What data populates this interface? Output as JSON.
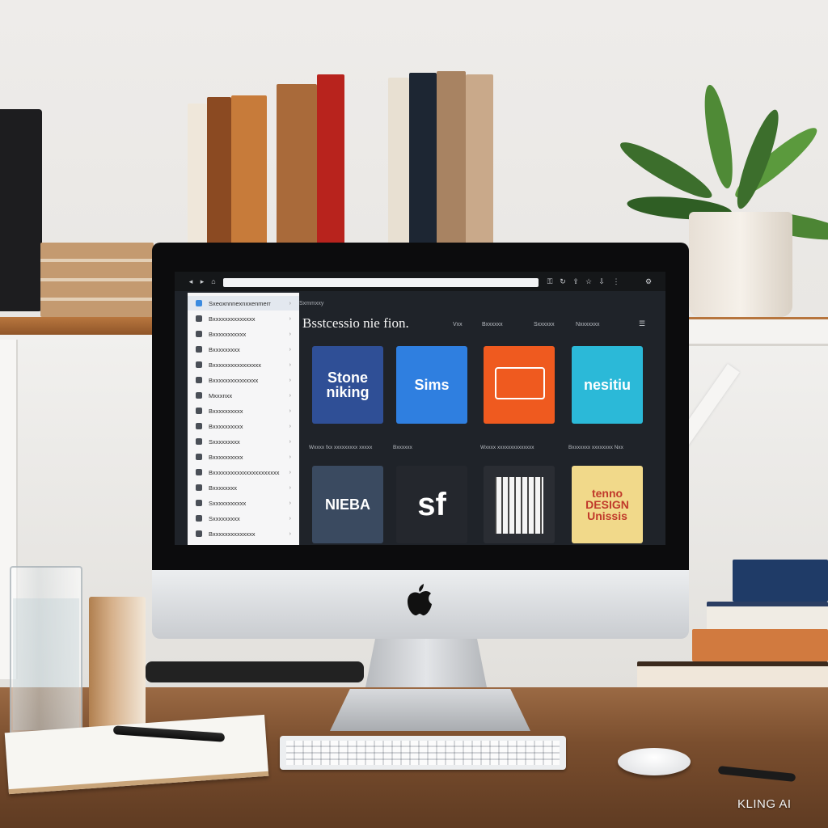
{
  "watermark": "KLING AI",
  "browser": {
    "url": "",
    "toolbar_icons": [
      "lock-icon",
      "refresh-icon",
      "share-icon",
      "bookmark-icon",
      "download-icon",
      "extensions-icon"
    ]
  },
  "sidebar": {
    "items": [
      {
        "label": "Sxeoxnnnexnxxenmerr",
        "icon": "folder-icon"
      },
      {
        "label": "Bxxxxxxxxxxxxxx",
        "icon": "folder-icon"
      },
      {
        "label": "Bxxxxxxxxxxx",
        "icon": "folder-icon"
      },
      {
        "label": "Bxxxxxxxxx",
        "icon": "folder-icon"
      },
      {
        "label": "Bxxxxxxxxxxxxxxxx",
        "icon": "folder-icon"
      },
      {
        "label": "Bxxxxxxxxxxxxxxx",
        "icon": "folder-icon"
      },
      {
        "label": "Mxxxnxx",
        "icon": "folder-icon"
      },
      {
        "label": "Bxxxxxxxxxx",
        "icon": "folder-icon"
      },
      {
        "label": "Bxxxxxxxxxx",
        "icon": "folder-icon"
      },
      {
        "label": "Sxxxxxxxxx",
        "icon": "folder-icon"
      },
      {
        "label": "Bxxxxxxxxxx",
        "icon": "folder-icon"
      },
      {
        "label": "Bxxxxxxxxxxxxxxxxxxxxxx",
        "icon": "folder-icon"
      },
      {
        "label": "Bxxxxxxxx",
        "icon": "folder-icon"
      },
      {
        "label": "Sxxxxxxxxxxx",
        "icon": "folder-icon"
      },
      {
        "label": "Sxxxxxxxxx",
        "icon": "folder-icon"
      },
      {
        "label": "Bxxxxxxxxxxxxxx",
        "icon": "folder-icon"
      }
    ]
  },
  "main": {
    "breadcrumb": "Sxmmxxy",
    "title": "Bsstcessio nie fion.",
    "nav": [
      "Vxx",
      "Bxxxxxx",
      "Sxxxxxx",
      "Nxxxxxxx"
    ],
    "tiles": [
      {
        "art": "Stone\nniking",
        "caption": "Wxxxx fxx xxxxxxxxx xxxxx",
        "bg": "#2f4f96"
      },
      {
        "art": "Sims",
        "caption": "Bxxxxxx",
        "bg": "#2f7fe0"
      },
      {
        "art": "",
        "caption": "Wxxxx xxxxxxxxxxxxxx",
        "bg": "#ef5a1f"
      },
      {
        "art": "nesitiu",
        "caption": "Bxxxxxxx xxxxxxxx Nxx",
        "bg": "#2bb9d8"
      },
      {
        "art": "NIEBA",
        "caption": "",
        "bg": "#3a4a60"
      },
      {
        "art": "sf",
        "caption": "",
        "bg": "#24272d"
      },
      {
        "art": "",
        "caption": "",
        "bg": "#2a2d33"
      },
      {
        "art": "tenno\nDESIGN\nUnissis",
        "caption": "",
        "bg": "#f1d98a"
      }
    ]
  },
  "colors": {
    "screen_bg": "#1f2329",
    "sidebar_bg": "#f6f6f7",
    "desk": "#7a4e2e"
  }
}
